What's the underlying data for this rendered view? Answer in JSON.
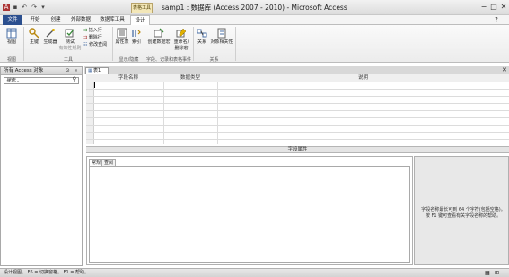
{
  "window": {
    "title": "samp1 : 数据库 (Access 2007 - 2010) - Microsoft Access",
    "context_tab_group": "表格工具",
    "controls": {
      "minimize": "−",
      "maximize": "□",
      "close": "✕"
    }
  },
  "quick_access": {
    "icons": [
      "access-logo-icon",
      "save-icon",
      "undo-icon",
      "redo-icon",
      "customize-icon"
    ]
  },
  "ribbon_tabs": [
    {
      "label": "文件"
    },
    {
      "label": "开始"
    },
    {
      "label": "创建"
    },
    {
      "label": "外部数据"
    },
    {
      "label": "数据库工具"
    },
    {
      "label": "设计"
    }
  ],
  "ribbon": {
    "groups": {
      "views": {
        "label": "视图",
        "view_button": "视图"
      },
      "tools": {
        "label": "工具",
        "primary_key": "主键",
        "builder": "生成器",
        "test_rules": "测试",
        "test_rules_sub": "有效性规则",
        "insert_rows": "插入行",
        "delete_rows": "删除行",
        "modify_lookups": "修改查阅"
      },
      "show_hide": {
        "label": "显示/隐藏",
        "property_sheet": "属性表",
        "indexes": "索引"
      },
      "field_events": {
        "label": "字段、记录和表格事件",
        "create_macros": "创建数据宏",
        "rename_delete": "重命名/",
        "rename_delete_2": "删除宏"
      },
      "relationships": {
        "label": "关系",
        "relationships": "关系",
        "object_dependencies": "对象相关性"
      }
    }
  },
  "nav_pane": {
    "header": "所有 Access 对象",
    "search_placeholder": "搜索..."
  },
  "document_tab": {
    "label": "表1"
  },
  "design_grid": {
    "columns": [
      "字段名称",
      "数据类型",
      "说明"
    ]
  },
  "field_properties": {
    "bar_label": "字段属性",
    "tabs": [
      "常规",
      "查阅"
    ],
    "help_text": "字段名称最长可到 64 个字符(包括空格)。按 F1 键可查看有关字段名称的帮助。"
  },
  "status_bar": {
    "text": "设计视图。 F6 = 切换窗格。 F1 = 帮助。"
  }
}
